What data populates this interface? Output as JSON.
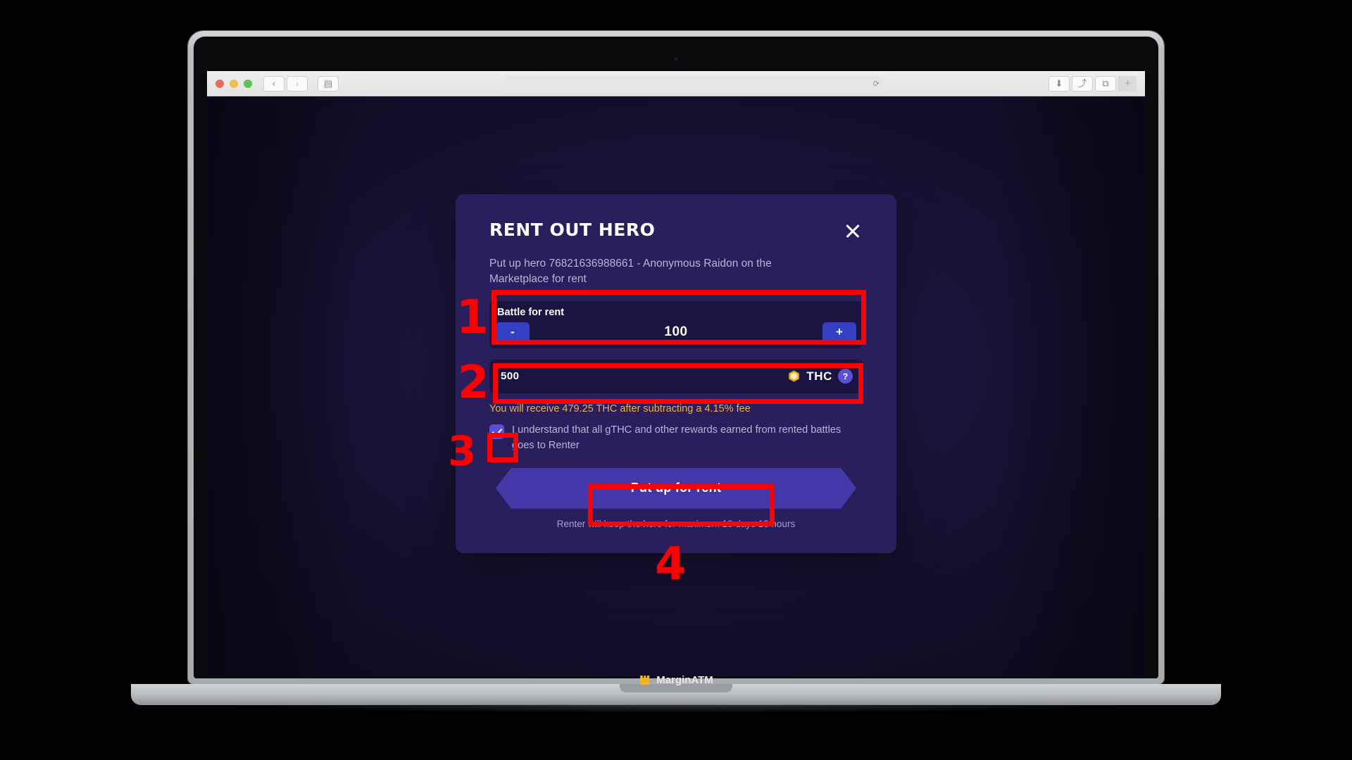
{
  "browser": {
    "traffic_lights": [
      "close",
      "minimize",
      "maximize"
    ],
    "back_label": "‹",
    "forward_label": "›",
    "sidebar_label": "▤",
    "reload_label": "⟳",
    "address_value": "",
    "download_label": "⬇",
    "share_label": "⤴",
    "tabs_label": "⧉",
    "new_tab_label": "+"
  },
  "modal": {
    "title": "RENT OUT HERO",
    "close_label": "close-icon",
    "subtitle": "Put up hero 76821636988661 - Anonymous Raidon on the Marketplace for rent",
    "battle_field": {
      "label": "Battle for rent",
      "decrement_label": "-",
      "value": "100",
      "increment_label": "+"
    },
    "price_field": {
      "value": "500",
      "currency": "THC",
      "coin_icon": "thc-coin-icon",
      "help_label": "?"
    },
    "fee_note": "You will receive 479.25 THC after subtracting a 4.15% fee",
    "consent": {
      "checked": true,
      "text": "I understand that all gTHC and other rewards earned from rented battles goes to Renter"
    },
    "cta_label": "Put up for rent",
    "foot_note": "Renter will keep the hero for maximum 18 days 18 hours"
  },
  "annotations": {
    "step_1": "1",
    "step_2": "2",
    "step_3": "3",
    "step_4": "4"
  },
  "watermark": {
    "brand": "MarginATM",
    "icon": "crown-icon"
  },
  "colors": {
    "modal_bg": "#2a1f5c",
    "field_bg": "#1c1440",
    "accent_blue": "#3340c4",
    "accent_purple": "#5c4fd6",
    "cta_bg": "#4438a8",
    "fee_gold": "#e8b04a",
    "annotation_red": "#ff0000",
    "coin_gold": "#e0a83b"
  }
}
